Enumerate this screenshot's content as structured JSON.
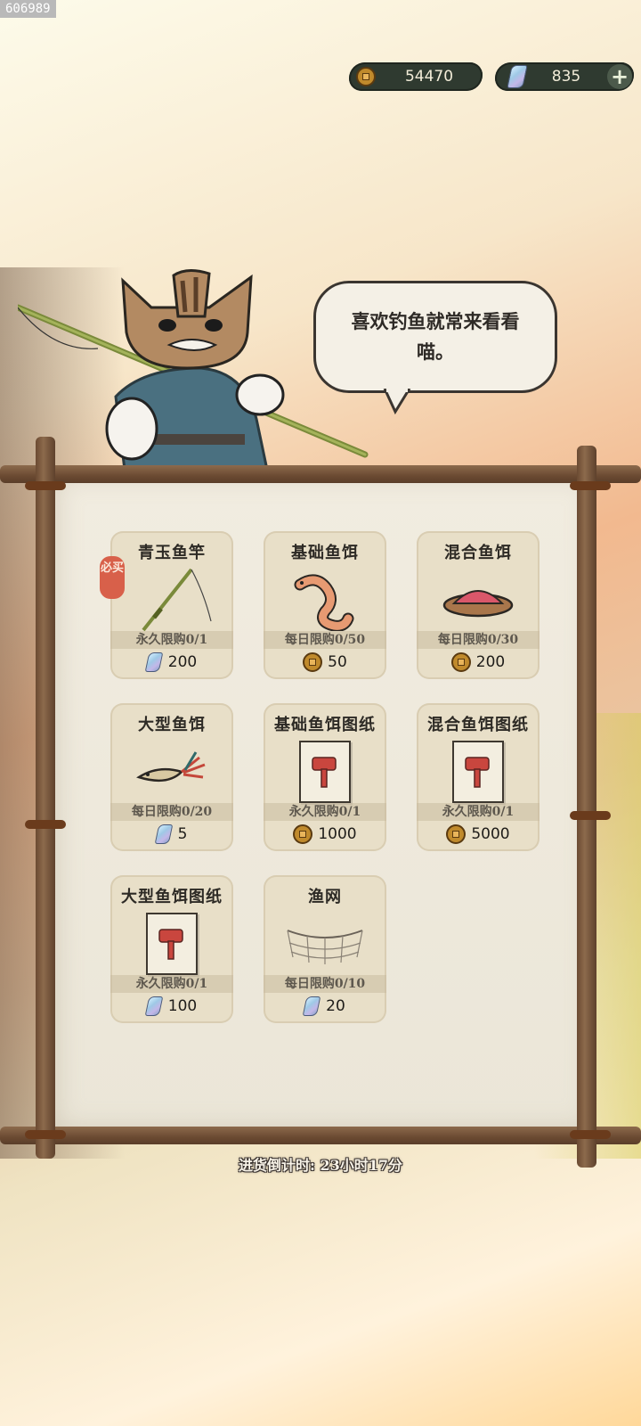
{
  "build_id": "606989",
  "currency": {
    "coins": "54470",
    "gems": "835",
    "add_label": "+"
  },
  "npc": {
    "speech_line1": "喜欢钓鱼就常来看看",
    "speech_line2": "喵。"
  },
  "shop": {
    "items": [
      {
        "name": "青玉鱼竿",
        "limit": "永久限购0/1",
        "price": "200",
        "currency": "gem",
        "badge": "必买",
        "icon": "fishing-rod-icon"
      },
      {
        "name": "基础鱼饵",
        "limit": "每日限购0/50",
        "price": "50",
        "currency": "coin",
        "icon": "worm-bait-icon"
      },
      {
        "name": "混合鱼饵",
        "limit": "每日限购0/30",
        "price": "200",
        "currency": "coin",
        "icon": "mixed-bait-bowl-icon"
      },
      {
        "name": "大型鱼饵",
        "limit": "每日限购0/20",
        "price": "5",
        "currency": "gem",
        "icon": "lure-fish-icon"
      },
      {
        "name": "基础鱼饵图纸",
        "limit": "永久限购0/1",
        "price": "1000",
        "currency": "coin",
        "icon": "hammer-blueprint-icon"
      },
      {
        "name": "混合鱼饵图纸",
        "limit": "永久限购0/1",
        "price": "5000",
        "currency": "coin",
        "icon": "hammer-blueprint-icon"
      },
      {
        "name": "大型鱼饵图纸",
        "limit": "永久限购0/1",
        "price": "100",
        "currency": "gem",
        "icon": "hammer-blueprint-icon"
      },
      {
        "name": "渔网",
        "limit": "每日限购0/10",
        "price": "20",
        "currency": "gem",
        "icon": "fishing-net-icon"
      }
    ],
    "restock_countdown": "进货倒计时: 23小时17分"
  },
  "colors": {
    "coin": "#c08a2c",
    "badge": "#d8604a",
    "card": "#e8dfc8",
    "wood": "#6b4a32"
  }
}
